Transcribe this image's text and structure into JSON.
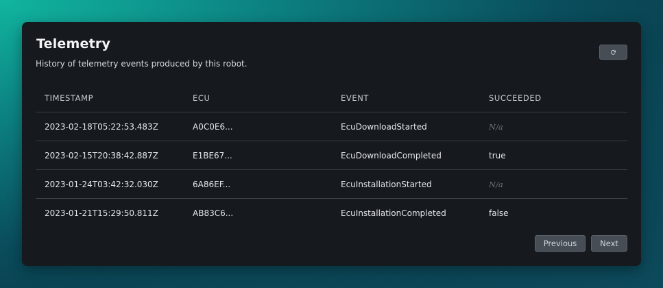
{
  "card": {
    "title": "Telemetry",
    "subtitle": "History of telemetry events produced by this robot.",
    "refresh_icon": "refresh-icon"
  },
  "table": {
    "columns": [
      "TIMESTAMP",
      "ECU",
      "EVENT",
      "SUCCEEDED"
    ],
    "rows": [
      {
        "timestamp": "2023-02-18T05:22:53.483Z",
        "ecu": "A0C0E6...",
        "event": "EcuDownloadStarted",
        "succeeded": "N/a"
      },
      {
        "timestamp": "2023-02-15T20:38:42.887Z",
        "ecu": "E1BE67...",
        "event": "EcuDownloadCompleted",
        "succeeded": "true"
      },
      {
        "timestamp": "2023-01-24T03:42:32.030Z",
        "ecu": "6A86EF...",
        "event": "EcuInstallationStarted",
        "succeeded": "N/a"
      },
      {
        "timestamp": "2023-01-21T15:29:50.811Z",
        "ecu": "AB83C6...",
        "event": "EcuInstallationCompleted",
        "succeeded": "false"
      }
    ]
  },
  "pagination": {
    "previous_label": "Previous",
    "next_label": "Next"
  },
  "colors": {
    "card_background": "#16191d",
    "button_background": "#474d54",
    "na_text": "#6c737b"
  }
}
